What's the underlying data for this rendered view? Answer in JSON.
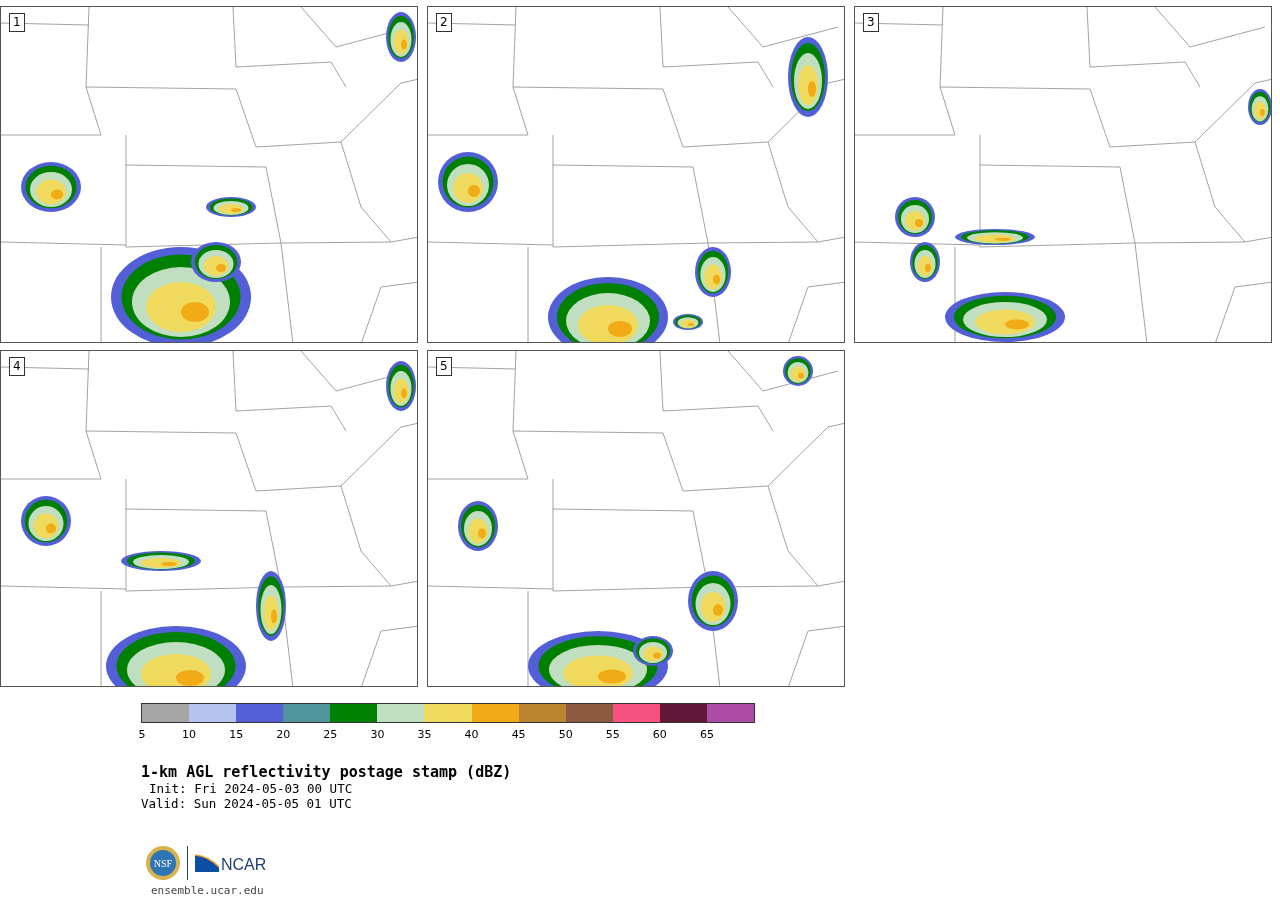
{
  "panels": [
    {
      "label": "1"
    },
    {
      "label": "2"
    },
    {
      "label": "3"
    },
    {
      "label": "4"
    },
    {
      "label": "5"
    }
  ],
  "colorbar": {
    "segments": [
      {
        "color": "#a5a5a5",
        "tick": "5"
      },
      {
        "color": "#b7c3ef",
        "tick": "10"
      },
      {
        "color": "#525fd6",
        "tick": "15"
      },
      {
        "color": "#50959b",
        "tick": "20"
      },
      {
        "color": "#008000",
        "tick": "25"
      },
      {
        "color": "#c0dec0",
        "tick": "30"
      },
      {
        "color": "#f0da5e",
        "tick": "35"
      },
      {
        "color": "#f0ab16",
        "tick": "40"
      },
      {
        "color": "#bb8431",
        "tick": "45"
      },
      {
        "color": "#8b5a3f",
        "tick": "50"
      },
      {
        "color": "#f65281",
        "tick": "55"
      },
      {
        "color": "#621837",
        "tick": "60"
      },
      {
        "color": "#ad4ca5",
        "tick": "65"
      }
    ]
  },
  "title": "1-km AGL reflectivity postage stamp (dBZ)",
  "init": "Init: Fri 2024-05-03 00 UTC",
  "valid": "Valid: Sun 2024-05-05 01 UTC",
  "logo": {
    "nsf": "NSF",
    "ncar": "NCAR"
  },
  "footer": "ensemble.ucar.edu"
}
